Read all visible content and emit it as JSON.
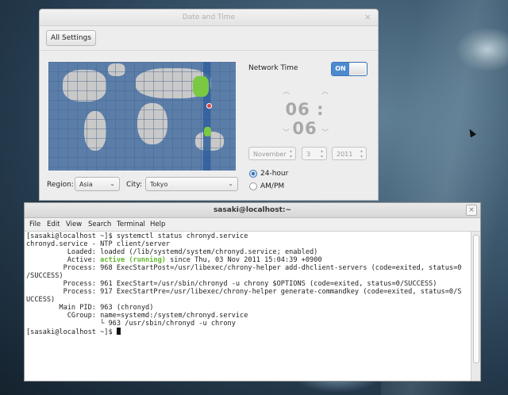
{
  "dialog": {
    "title": "Date and Time",
    "close_glyph": "×",
    "all_settings": "All Settings",
    "network_time_label": "Network Time",
    "network_time_switch": "ON",
    "hour": "06",
    "minute": "06",
    "time_separator": ":",
    "month": "November",
    "day": "3",
    "year": "2011",
    "format_24h": "24-hour",
    "format_ampm": "AM/PM",
    "format_selected": "24-hour",
    "region_label": "Region:",
    "region_value": "Asia",
    "city_label": "City:",
    "city_value": "Tokyo",
    "accent_color": "#4b8ad0",
    "highlight_color": "#7ac943"
  },
  "terminal": {
    "title": "sasaki@localhost:~",
    "close_glyph": "×",
    "menu": [
      "File",
      "Edit",
      "View",
      "Search",
      "Terminal",
      "Help"
    ],
    "lines": [
      "[sasaki@localhost ~]$ systemctl status chronyd.service",
      "chronyd.service - NTP client/server",
      "          Loaded: loaded (/lib/systemd/system/chronyd.service; enabled)",
      "          Active: ",
      "active (running)",
      " since Thu, 03 Nov 2011 15:04:39 +0900",
      "         Process: 968 ExecStartPost=/usr/libexec/chrony-helper add-dhclient-servers (code=exited, status=0",
      "/SUCCESS)",
      "         Process: 961 ExecStart=/usr/sbin/chronyd -u chrony $OPTIONS (code=exited, status=0/SUCCESS)",
      "         Process: 917 ExecStartPre=/usr/libexec/chrony-helper generate-commandkey (code=exited, status=0/S",
      "UCCESS)",
      "        Main PID: 963 (chronyd)",
      "          CGroup: name=systemd:/system/chronyd.service",
      "                  └ 963 /usr/sbin/chronyd -u chrony",
      "[sasaki@localhost ~]$ "
    ],
    "status_color": "#5fb82a"
  }
}
